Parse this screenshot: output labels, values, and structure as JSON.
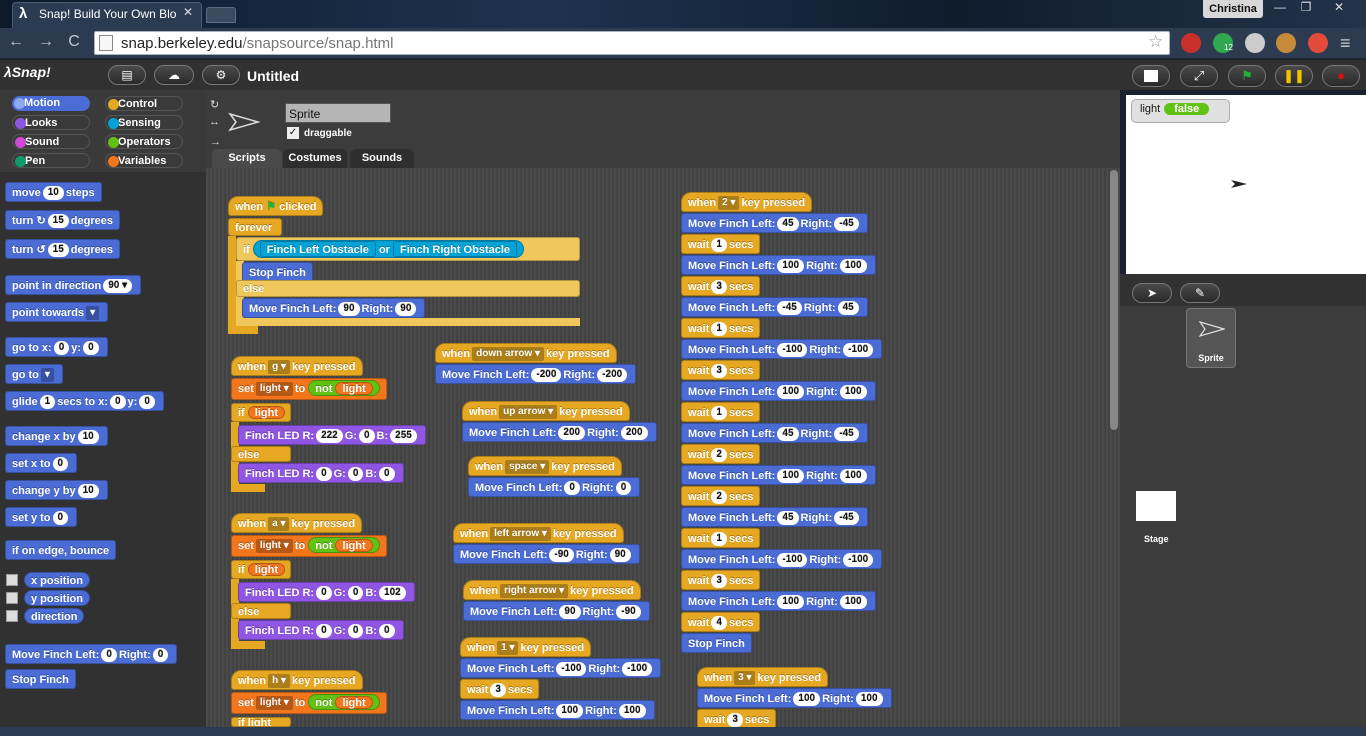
{
  "browser": {
    "tab_title": "Snap! Build Your Own Blo",
    "tab_close": "✕",
    "profile_name": "Christina",
    "window_controls": [
      "—",
      "❐",
      "✕"
    ],
    "nav": {
      "back": "←",
      "forward": "→",
      "reload": "C"
    },
    "url_host": "snap.berkeley.edu",
    "url_path": "/snapsource/snap.html",
    "star": "☆",
    "menu": "≡",
    "ext_badge": "12"
  },
  "snap": {
    "logo": "λSnap!",
    "project_title": "Untitled",
    "topbar_icons": [
      "file-icon",
      "cloud-icon",
      "settings-icon"
    ],
    "categories": [
      {
        "label": "Motion",
        "color": "#4a6cd4",
        "selected": true
      },
      {
        "label": "Control",
        "color": "#e6a822"
      },
      {
        "label": "Looks",
        "color": "#8f56e3"
      },
      {
        "label": "Sensing",
        "color": "#04a3d7"
      },
      {
        "label": "Sound",
        "color": "#cf4ad9"
      },
      {
        "label": "Operators",
        "color": "#62c213"
      },
      {
        "label": "Pen",
        "color": "#0e9a6c"
      },
      {
        "label": "Variables",
        "color": "#f3761d"
      }
    ],
    "palette": {
      "move": [
        "move",
        "10",
        "steps"
      ],
      "turn_cw": [
        "turn",
        "↻",
        "15",
        "degrees"
      ],
      "turn_ccw": [
        "turn",
        "↺",
        "15",
        "degrees"
      ],
      "point_dir": [
        "point in direction",
        "90 ▾"
      ],
      "point_towards": [
        "point towards",
        "▾"
      ],
      "goto_xy": [
        "go to x:",
        "0",
        "y:",
        "0"
      ],
      "goto": [
        "go to",
        "▾"
      ],
      "glide": [
        "glide",
        "1",
        "secs to x:",
        "0",
        "y:",
        "0"
      ],
      "change_x": [
        "change x by",
        "10"
      ],
      "set_x": [
        "set x to",
        "0"
      ],
      "change_y": [
        "change y by",
        "10"
      ],
      "set_y": [
        "set y to",
        "0"
      ],
      "bounce": "if on edge, bounce",
      "x_pos": "x position",
      "y_pos": "y position",
      "direction": "direction",
      "finch_move": [
        "Move Finch Left:",
        "0",
        "Right:",
        "0"
      ],
      "stop_finch": "Stop Finch"
    },
    "sprite": {
      "name": "Sprite",
      "draggable_label": "draggable",
      "check": "✓",
      "tabs": [
        "Scripts",
        "Costumes",
        "Sounds"
      ]
    },
    "stage": {
      "watcher_label": "light",
      "watcher_value": "false",
      "stage_label": "Stage",
      "sprite_label": "Sprite"
    },
    "scripts": {
      "flag_script": {
        "hat": [
          "when",
          "⚑",
          "clicked"
        ],
        "forever": "forever",
        "if": "if",
        "left_obstacle": "Finch Left Obstacle",
        "or": "or",
        "right_obstacle": "Finch Right Obstacle",
        "stop": "Stop Finch",
        "else": "else",
        "move": [
          "Move Finch Left:",
          "90",
          "Right:",
          "90"
        ]
      },
      "g_script": {
        "hat": [
          "when",
          "g ▾",
          "key pressed"
        ],
        "set": [
          "set",
          "light ▾",
          "to"
        ],
        "not": "not",
        "light": "light",
        "if": "if",
        "led1": [
          "Finch LED R:",
          "222",
          "G:",
          "0",
          "B:",
          "255"
        ],
        "else": "else",
        "led2": [
          "Finch LED R:",
          "0",
          "G:",
          "0",
          "B:",
          "0"
        ]
      },
      "a_script": {
        "hat": [
          "when",
          "a ▾",
          "key pressed"
        ],
        "set": [
          "set",
          "light ▾",
          "to"
        ],
        "not": "not",
        "light": "light",
        "if": "if",
        "led1": [
          "Finch LED R:",
          "0",
          "G:",
          "0",
          "B:",
          "102"
        ],
        "else": "else",
        "led2": [
          "Finch LED R:",
          "0",
          "G:",
          "0",
          "B:",
          "0"
        ]
      },
      "h_script": {
        "hat": [
          "when",
          "h ▾",
          "key pressed"
        ],
        "set": [
          "set",
          "light ▾",
          "to"
        ],
        "not": "not",
        "light": "light",
        "if": "if",
        "light2": "light"
      },
      "down_script": {
        "hat": [
          "when",
          "down arrow ▾",
          "key pressed"
        ],
        "move": [
          "Move Finch Left:",
          "-200",
          "Right:",
          "-200"
        ]
      },
      "up_script": {
        "hat": [
          "when",
          "up arrow ▾",
          "key pressed"
        ],
        "move": [
          "Move Finch Left:",
          "200",
          "Right:",
          "200"
        ]
      },
      "space_script": {
        "hat": [
          "when",
          "space ▾",
          "key pressed"
        ],
        "move": [
          "Move Finch Left:",
          "0",
          "Right:",
          "0"
        ]
      },
      "left_script": {
        "hat": [
          "when",
          "left arrow ▾",
          "key pressed"
        ],
        "move": [
          "Move Finch Left:",
          "-90",
          "Right:",
          "90"
        ]
      },
      "right_script": {
        "hat": [
          "when",
          "right arrow ▾",
          "key pressed"
        ],
        "move": [
          "Move Finch Left:",
          "90",
          "Right:",
          "-90"
        ]
      },
      "one_script": {
        "hat": [
          "when",
          "1 ▾",
          "key pressed"
        ],
        "move1": [
          "Move Finch Left:",
          "-100",
          "Right:",
          "-100"
        ],
        "wait": [
          "wait",
          "3",
          "secs"
        ],
        "move2": [
          "Move Finch Left:",
          "100",
          "Right:",
          "100"
        ]
      },
      "two_script": {
        "hat": [
          "when",
          "2 ▾",
          "key pressed"
        ],
        "steps": [
          {
            "type": "move",
            "l": "45",
            "r": "-45"
          },
          {
            "type": "wait",
            "s": "1"
          },
          {
            "type": "move",
            "l": "100",
            "r": "100"
          },
          {
            "type": "wait",
            "s": "3"
          },
          {
            "type": "move",
            "l": "-45",
            "r": "45"
          },
          {
            "type": "wait",
            "s": "1"
          },
          {
            "type": "move",
            "l": "-100",
            "r": "-100"
          },
          {
            "type": "wait",
            "s": "3"
          },
          {
            "type": "move",
            "l": "100",
            "r": "100"
          },
          {
            "type": "wait",
            "s": "1"
          },
          {
            "type": "move",
            "l": "45",
            "r": "-45"
          },
          {
            "type": "wait",
            "s": "2"
          },
          {
            "type": "move",
            "l": "100",
            "r": "100"
          },
          {
            "type": "wait",
            "s": "2"
          },
          {
            "type": "move",
            "l": "45",
            "r": "-45"
          },
          {
            "type": "wait",
            "s": "1"
          },
          {
            "type": "move",
            "l": "-100",
            "r": "-100"
          },
          {
            "type": "wait",
            "s": "3"
          },
          {
            "type": "move",
            "l": "100",
            "r": "100"
          },
          {
            "type": "wait",
            "s": "4"
          },
          {
            "type": "stop"
          }
        ],
        "move_label": "Move Finch Left:",
        "right_label": "Right:",
        "wait_label": "wait",
        "secs_label": "secs",
        "stop_label": "Stop Finch"
      },
      "three_script": {
        "hat": [
          "when",
          "3 ▾",
          "key pressed"
        ],
        "move": [
          "Move Finch Left:",
          "100",
          "Right:",
          "100"
        ],
        "wait": [
          "wait",
          "3",
          "secs"
        ]
      }
    }
  }
}
